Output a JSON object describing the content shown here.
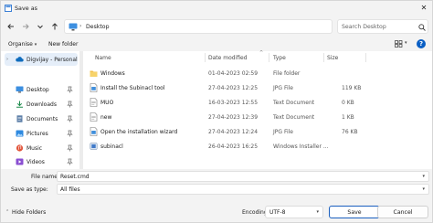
{
  "window": {
    "title": "Save as",
    "close_glyph": "✕"
  },
  "nav": {
    "back": "back-arrow-icon",
    "forward": "forward-arrow-icon",
    "recent": "chevron-down-icon",
    "up": "up-arrow-icon",
    "address": "Desktop",
    "search_placeholder": "Search Desktop"
  },
  "toolbar": {
    "organise": "Organise",
    "new_folder": "New folder"
  },
  "sidebar": {
    "onedrive": "Digvijay - Personal",
    "items": [
      {
        "label": "Desktop"
      },
      {
        "label": "Downloads"
      },
      {
        "label": "Documents"
      },
      {
        "label": "Pictures"
      },
      {
        "label": "Music"
      },
      {
        "label": "Videos"
      }
    ]
  },
  "columns": {
    "name": "Name",
    "date": "Date modified",
    "type": "Type",
    "size": "Size"
  },
  "files": [
    {
      "name": "Windows",
      "date": "01-04-2023 02:59",
      "type": "File folder",
      "size": "",
      "icon": "folder-icon"
    },
    {
      "name": "Install the Subinacl tool",
      "date": "27-04-2023 12:25",
      "type": "JPG File",
      "size": "119 KB",
      "icon": "image-file-icon"
    },
    {
      "name": "MUO",
      "date": "16-03-2023 12:55",
      "type": "Text Document",
      "size": "0 KB",
      "icon": "text-file-icon"
    },
    {
      "name": "new",
      "date": "27-04-2023 12:39",
      "type": "Text Document",
      "size": "1 KB",
      "icon": "text-file-icon"
    },
    {
      "name": "Open the installation wizard",
      "date": "27-04-2023 12:24",
      "type": "JPG File",
      "size": "76 KB",
      "icon": "image-file-icon"
    },
    {
      "name": "subinacl",
      "date": "26-04-2023 16:25",
      "type": "Windows Installer ...",
      "size": "",
      "icon": "installer-icon"
    }
  ],
  "fields": {
    "file_name_label": "File name:",
    "file_name_value": "Reset.cmd",
    "save_type_label": "Save as type:",
    "save_type_value": "All files"
  },
  "footer": {
    "hide_folders": "Hide Folders",
    "encoding_label": "Encoding:",
    "encoding_value": "UTF-8",
    "save": "Save",
    "cancel": "Cancel"
  },
  "colors": {
    "accent": "#0a5fc4",
    "folder": "#f2c04d",
    "selected": "#e5eef9"
  }
}
